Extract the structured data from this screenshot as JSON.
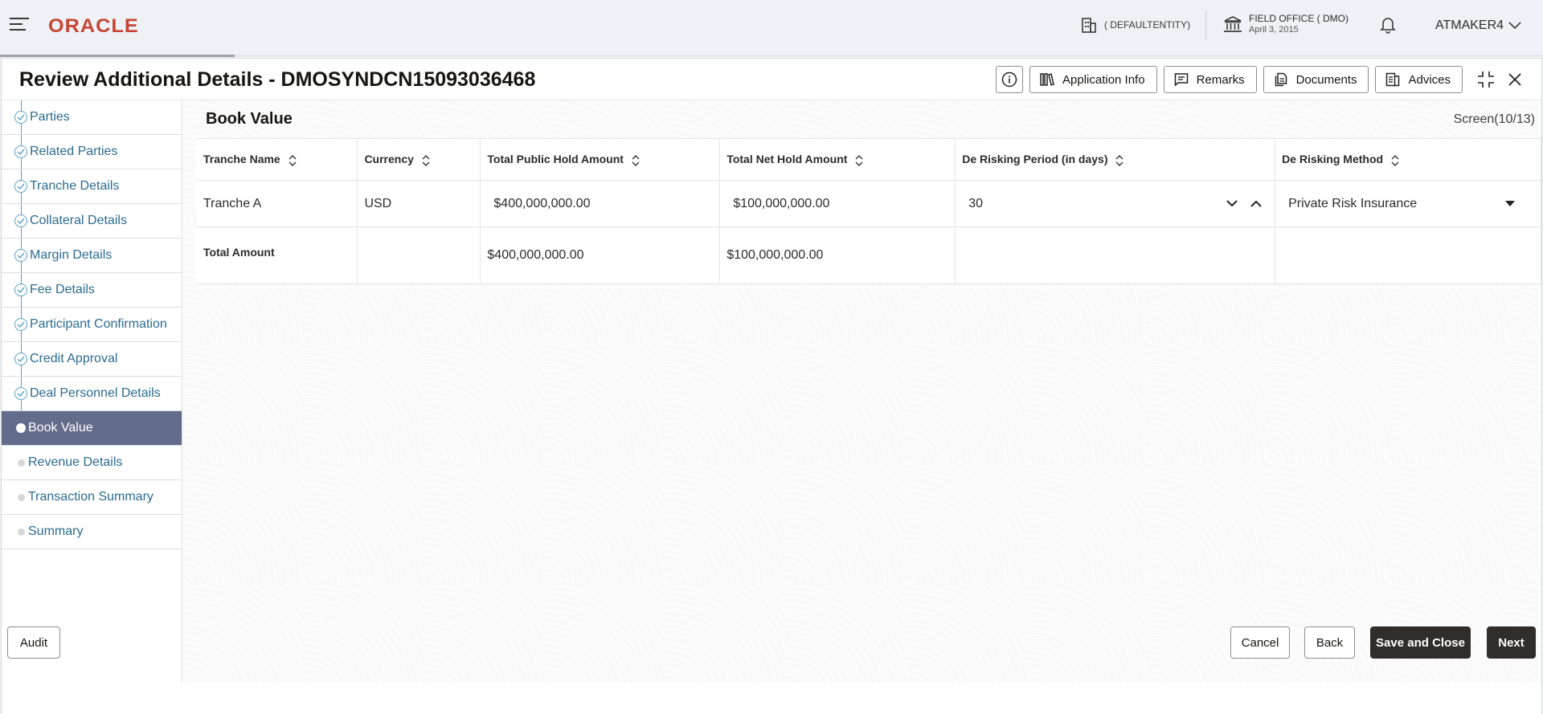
{
  "header": {
    "logo": "ORACLE",
    "entity": "( DEFAULTENTITY)",
    "office_line1": "FIELD OFFICE ( DMO)",
    "office_line2": "April 3, 2015",
    "user": "ATMAKER4"
  },
  "modal": {
    "title": "Review Additional Details - DMOSYNDCN15093036468",
    "buttons": {
      "application_info": "Application Info",
      "remarks": "Remarks",
      "documents": "Documents",
      "advices": "Advices"
    }
  },
  "sidebar": {
    "items": [
      {
        "label": "Parties",
        "state": "done"
      },
      {
        "label": "Related Parties",
        "state": "done"
      },
      {
        "label": "Tranche Details",
        "state": "done"
      },
      {
        "label": "Collateral Details",
        "state": "done"
      },
      {
        "label": "Margin Details",
        "state": "done"
      },
      {
        "label": "Fee Details",
        "state": "done"
      },
      {
        "label": "Participant Confirmation",
        "state": "done"
      },
      {
        "label": "Credit Approval",
        "state": "done"
      },
      {
        "label": "Deal Personnel Details",
        "state": "done"
      },
      {
        "label": "Book Value",
        "state": "active"
      },
      {
        "label": "Revenue Details",
        "state": "todo"
      },
      {
        "label": "Transaction Summary",
        "state": "todo"
      },
      {
        "label": "Summary",
        "state": "todo"
      }
    ]
  },
  "content": {
    "section_title": "Book Value",
    "screen_count": "Screen(10/13)",
    "table": {
      "headers": [
        "Tranche Name",
        "Currency",
        "Total Public Hold Amount",
        "Total Net Hold Amount",
        "De Risking Period (in days)",
        "De Risking Method"
      ],
      "row": {
        "tranche_name": "Tranche A",
        "currency": "USD",
        "public_hold": "$400,000,000.00",
        "net_hold": "$100,000,000.00",
        "derisk_period": "30",
        "derisk_method": "Private Risk Insurance"
      },
      "total": {
        "label": "Total Amount",
        "public_hold": "$400,000,000.00",
        "net_hold": "$100,000,000.00"
      }
    }
  },
  "footer": {
    "audit": "Audit",
    "cancel": "Cancel",
    "back": "Back",
    "save_close": "Save and Close",
    "next": "Next"
  },
  "colors": {
    "brand": "#c74634",
    "active_nav": "#646c8c",
    "link": "#2b6b8f",
    "primary_button": "#312d2a"
  }
}
